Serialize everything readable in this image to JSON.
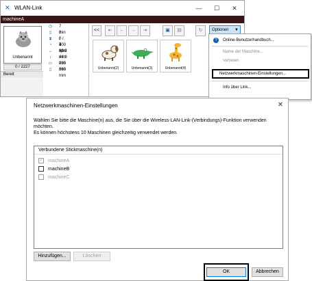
{
  "main_window": {
    "title": "WLAN-Link",
    "controls": {
      "minimize": "—",
      "maximize": "☐",
      "close": "✕"
    },
    "machine_name": "machineA",
    "preview": {
      "label": "Unbenannt",
      "counter": "0 / 2227"
    },
    "status": "Bereit",
    "stats": [
      {
        "icon": "clock-icon",
        "glyph": "◷",
        "value": "7 min"
      },
      {
        "icon": "spool-icon",
        "glyph": "▯",
        "value": "0 / 3"
      },
      {
        "icon": "time-elapsed-icon",
        "glyph": "⧗",
        "value": "0 / 7 min"
      },
      {
        "icon": "speed-icon",
        "glyph": "◔",
        "value": "400 spm"
      },
      {
        "icon": "width-icon",
        "glyph": "↔",
        "value": "30.2 mm"
      },
      {
        "icon": "height-icon",
        "glyph": "↕",
        "value": "44.9 mm"
      },
      {
        "icon": "hoop-width-icon",
        "glyph": "▭",
        "value": "200 mm"
      },
      {
        "icon": "hoop-height-icon",
        "glyph": "▯",
        "value": "360 mm"
      }
    ],
    "toolbar": {
      "scroll_left": "<<",
      "options_label": "Optionen",
      "options_arrow": "▼"
    },
    "thumbnails": [
      {
        "label": "Unbenannt(2)",
        "icon": "dog-design-icon"
      },
      {
        "label": "Unbenannt(3)",
        "icon": "crocodile-design-icon"
      },
      {
        "label": "Unbenannt(4)",
        "icon": "giraffe-design-icon"
      }
    ]
  },
  "options_menu": {
    "items": [
      {
        "label": "Online-Benutzerhandbuch...",
        "enabled": true
      },
      {
        "label": "Name der Maschine...",
        "enabled": false
      },
      {
        "label": "Verteilen",
        "enabled": false
      },
      {
        "label": "Netzwerkmaschinen-Einstellungen...",
        "enabled": true
      },
      {
        "label": "Info über Link...",
        "enabled": true
      }
    ]
  },
  "dialog": {
    "title": "Netzwerkmaschinen-Einstellungen",
    "close": "✕",
    "instruction_line1": "Wählen Sie bitte die Maschine(n) aus, die Sie über die Wireless-LAN-Link-(Verbindungs)-Funktion verwenden",
    "instruction_line2": "möchten.",
    "instruction_line3": "Es können höchstens 10 Maschinen gleichzeitig verwendet werden.",
    "list_header": "Verbundene Stickmaschine(n)",
    "machines": [
      {
        "name": "machineA",
        "checked": true,
        "enabled": false
      },
      {
        "name": "machineB",
        "checked": false,
        "enabled": true
      },
      {
        "name": "machineC",
        "checked": false,
        "enabled": false
      }
    ],
    "buttons": {
      "add": "Hinzufügen...",
      "delete": "Löschen",
      "ok": "OK",
      "cancel": "Abbrechen"
    }
  },
  "colors": {
    "machine_strip": "#3a1414",
    "options_button": "#cde3f7",
    "highlight_frame": "#000000"
  }
}
